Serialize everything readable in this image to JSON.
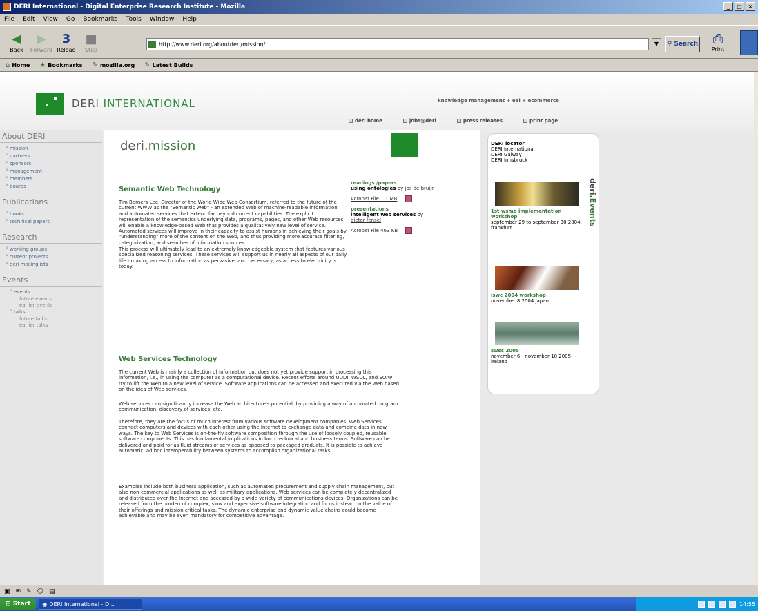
{
  "window": {
    "title": "DERI International - Digital Enterprise Research Institute - Mozilla"
  },
  "menu": [
    "File",
    "Edit",
    "View",
    "Go",
    "Bookmarks",
    "Tools",
    "Window",
    "Help"
  ],
  "toolbar": {
    "back": "Back",
    "forward": "Forward",
    "reload": "Reload",
    "stop": "Stop",
    "url": "http://www.deri.org/aboutderi/mission/",
    "search": "Search",
    "print": "Print"
  },
  "bookmarks": [
    "Home",
    "Bookmarks",
    "mozilla.org",
    "Latest Builds"
  ],
  "site": {
    "logo_a": "DERI ",
    "logo_b": "INTERNATIONAL",
    "tagline": "knowledge management + eai + ecommerce",
    "topnav": [
      "deri home",
      "jobs@deri",
      "press releases",
      "print page"
    ]
  },
  "leftnav": {
    "about": {
      "title": "About DERI",
      "items": [
        "mission",
        "partners",
        "sponsors",
        "management",
        "members",
        "boards"
      ]
    },
    "publications": {
      "title": "Publications",
      "items": [
        "books",
        "technical papers"
      ]
    },
    "research": {
      "title": "Research",
      "items": [
        "working groups",
        "current projects",
        "deri mailinglists"
      ]
    },
    "events": {
      "title": "Events",
      "events": "events",
      "future_events": "future events",
      "earlier_events": "earlier events",
      "talks": "talks",
      "future_talks": "future talks",
      "earlier_talks": "earlier talks"
    }
  },
  "content": {
    "title_a": "deri.",
    "title_b": "mission",
    "h_semantic": "Semantic Web Technology",
    "p1": "Tim Berners-Lee, Director of the World Wide Web Consortium, referred to the future of the current WWW as the \"Semantic Web\" - an extended Web of machine-readable information and automated services that extend far beyond current capabilities. The explicit representation of the semantics underlying data, programs, pages, and other Web resources, will enable a knowledge-based Web that provides a qualitatively new level of service. Automated services will improve in their capacity to assist humans in achieving their goals by \"understanding\" more of the content on the Web, and thus providing more accurate filtering, categorization, and searches of information sources.",
    "p2": "This process will ultimately lead to an extremely knowledgeable system that features various specialized reasoning services. These services will support us in nearly all aspects of our daily life - making access to information as pervasive, and necessary, as access to electricity is today.",
    "h_ws": "Web Services Technology",
    "p3": "The current Web is mainly a collection of information but does not yet provide support in processing this information, i.e., in using the computer as a computational device. Recent efforts around UDDI, WSDL, and SOAP try to lift the Web to a new level of service. Software applications can be accessed and executed via the Web based on the idea of Web services.",
    "p4": "Web services can significantly increase the Web architecture's potential, by providing a way of automated program communication, discovery of services, etc.",
    "p5": "Therefore, they are the focus of much interest from various software development companies. Web Services connect computers and devices with each other using the Internet to exchange data and combine data in new ways. The key to Web Services is on-the-fly software composition through the use of loosely coupled, reusable software components. This has fundamental implications in both technical and business terms. Software can be delivered and paid for as fluid streams of services as opposed to packaged products. It is possible to achieve automatic, ad hoc interoperability between systems to accomplish organizational tasks.",
    "p6": "Examples include both business application, such as automated procurement and supply chain management, but also non-commercial applications as well as military applications. Web services can be completely decentralized and distributed over the Internet and accessed by a wide variety of communications devices. Organizations can be released from the burden of complex, slow and expensive software integration and focus instead on the value of their offerings and mission critical tasks. The dynamic enterprise and dynamic value chains could become achievable and may be even mandatory for competitive advantage.",
    "links": {
      "readings": "readings /papers",
      "readings_bold": "using ontologies",
      "readings_by": " by ",
      "readings_author": "jos de bruijn",
      "file1": "Acrobat File 1.1 MB",
      "pres": "presentations",
      "pres_bold": "intelligent web services",
      "pres_by": " by ",
      "pres_author": "dieter fensel",
      "file2": "Acrobat File 463 KB"
    }
  },
  "right": {
    "locator_title": "DERI locator",
    "locators": [
      "DERI International",
      "DERI Galway",
      "DERI Innsbruck"
    ],
    "tab_a": "deri.",
    "tab_b": "Events",
    "ev1_t": "1st wsmo implementation workshop",
    "ev1_d": "september 29 to september 30 2004, frankfurt",
    "ev2_t": "iswc 2004 workshop",
    "ev2_d": "november 8 2004 japan",
    "ev3_t": "swsc 2005",
    "ev3_d": "november 6 - november 10 2005 ireland"
  },
  "taskbar": {
    "start": "Start",
    "task": "DERI International - D...",
    "clock": "14:55"
  }
}
